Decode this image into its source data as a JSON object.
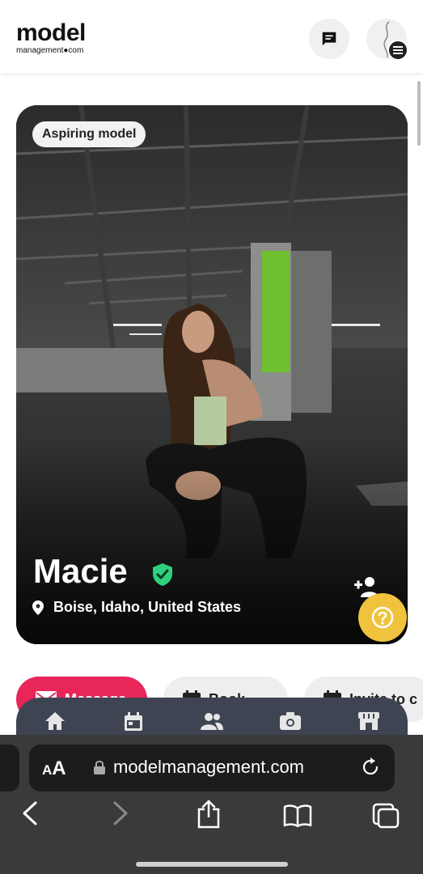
{
  "header": {
    "logo_main": "model",
    "logo_sub": "management●com",
    "messages_icon": "chat-icon",
    "menu_icon": "menu-icon"
  },
  "profile": {
    "status": "Aspiring model",
    "name": "Macie",
    "location": "Boise, Idaho, United States",
    "verified": true
  },
  "actions": {
    "message": "Message",
    "book": "Book",
    "invite": "Invite to c"
  },
  "bottom_nav": {
    "items": [
      "home-icon",
      "calendar-icon",
      "people-icon",
      "camera-icon",
      "store-icon"
    ]
  },
  "browser": {
    "aa_small": "A",
    "aa_big": "A",
    "url": "modelmanagement.com"
  },
  "colors": {
    "accent": "#e8265a",
    "verified": "#2ecf7e",
    "help": "#f0c23e",
    "nav_bg": "#3f4452"
  }
}
